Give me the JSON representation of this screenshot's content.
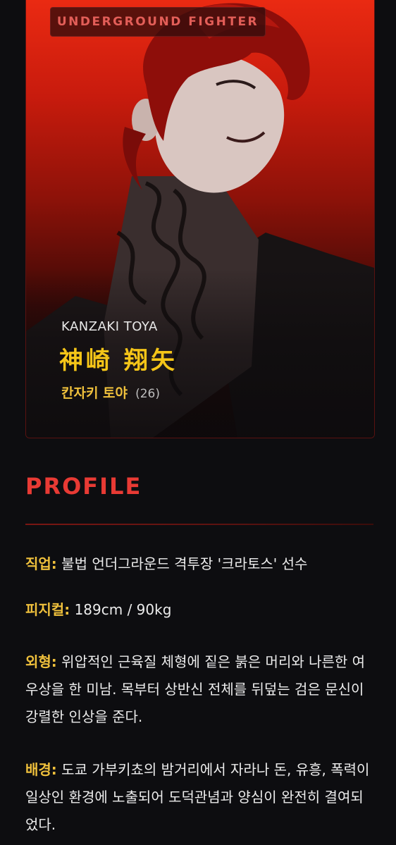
{
  "card": {
    "badge": "UNDERGROUND FIGHTER",
    "name_en": "KANZAKI TOYA",
    "name_kanji": "神崎 翔矢",
    "name_ko": "칸자키 토야",
    "age": "(26)"
  },
  "profile": {
    "title": "PROFILE",
    "fields": [
      {
        "label": "직업:",
        "value": "불법 언더그라운드 격투장 '크라토스' 선수"
      },
      {
        "label": "피지컬:",
        "value": "189cm / 90kg"
      },
      {
        "label": "외형:",
        "value": "위압적인 근육질 체형에 짙은 붉은 머리와 나른한 여우상을 한 미남. 목부터 상반신 전체를 뒤덮는 검은 문신이 강렬한 인상을 준다."
      },
      {
        "label": "배경:",
        "value": "도쿄 가부키쵸의 밤거리에서 자라나 돈, 유흥, 폭력이 일상인 환경에 노출되어 도덕관념과 양심이 완전히 결여되었다."
      }
    ]
  },
  "colors": {
    "accent_red": "#e83a34",
    "label_gold": "#efc03c",
    "kanji_gold": "#f5c518",
    "background": "#0d0d10"
  }
}
